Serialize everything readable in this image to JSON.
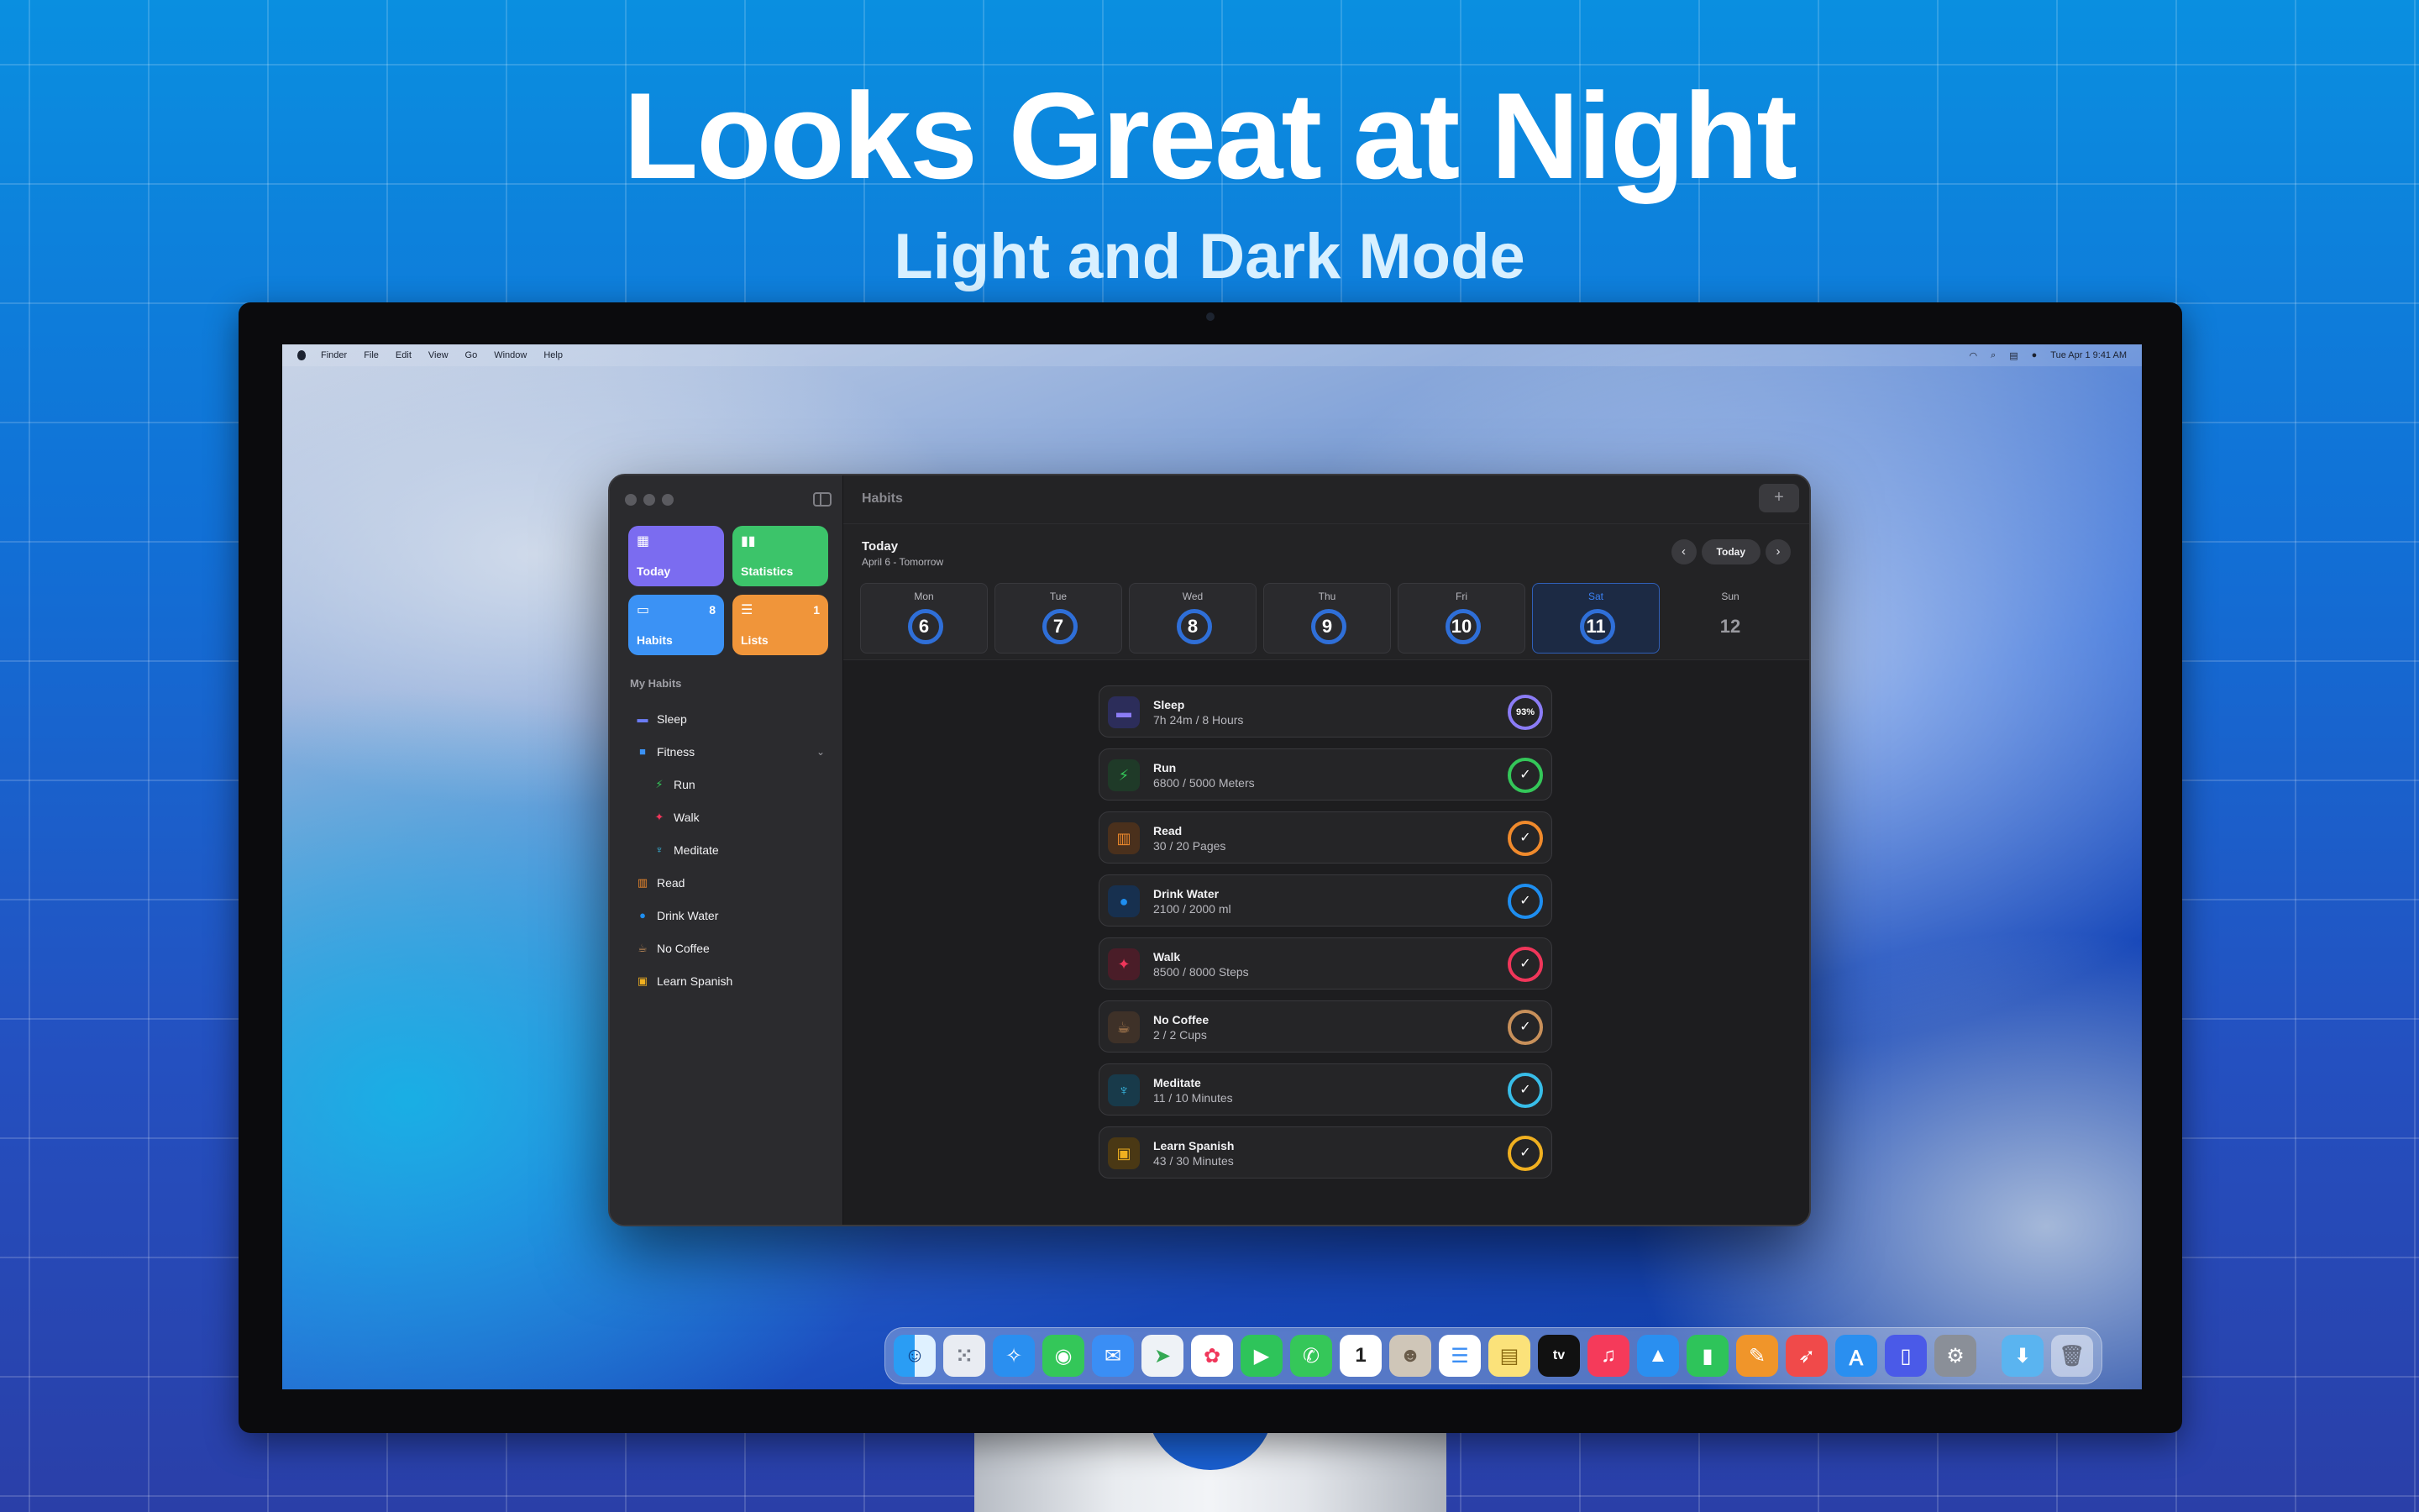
{
  "headline": "Looks Great at Night",
  "subheadline": "Light and Dark Mode",
  "menubar": {
    "items": [
      "Finder",
      "File",
      "Edit",
      "View",
      "Go",
      "Window",
      "Help"
    ],
    "clock": "Tue Apr 1  9:41 AM"
  },
  "app": {
    "title": "Habits",
    "tiles": [
      {
        "label": "Today",
        "count": "",
        "color": "#7b6cf0",
        "icon": "calendar-icon"
      },
      {
        "label": "Statistics",
        "count": "",
        "color": "#3cc46a",
        "icon": "bar-chart-icon"
      },
      {
        "label": "Habits",
        "count": "8",
        "color": "#3b92f5",
        "icon": "tray-icon"
      },
      {
        "label": "Lists",
        "count": "1",
        "color": "#f0953a",
        "icon": "list-icon"
      }
    ],
    "section_title": "My Habits",
    "nav": [
      {
        "label": "Sleep",
        "icon": "bed-icon"
      },
      {
        "label": "Fitness",
        "icon": "folder-icon"
      },
      {
        "label": "Run",
        "icon": "runner-icon"
      },
      {
        "label": "Walk",
        "icon": "walker-icon"
      },
      {
        "label": "Meditate",
        "icon": "meditate-icon"
      },
      {
        "label": "Read",
        "icon": "book-icon"
      },
      {
        "label": "Drink Water",
        "icon": "drop-icon"
      },
      {
        "label": "No Coffee",
        "icon": "cup-icon"
      },
      {
        "label": "Learn Spanish",
        "icon": "phrasebook-icon"
      }
    ],
    "header": {
      "today": "Today",
      "date": "April 6 - Tomorrow",
      "today_button": "Today",
      "add": "+"
    },
    "days": [
      {
        "name": "Mon",
        "num": "6"
      },
      {
        "name": "Tue",
        "num": "7"
      },
      {
        "name": "Wed",
        "num": "8"
      },
      {
        "name": "Thu",
        "num": "9"
      },
      {
        "name": "Fri",
        "num": "10"
      },
      {
        "name": "Sat",
        "num": "11"
      },
      {
        "name": "Sun",
        "num": "12"
      }
    ],
    "habits": [
      {
        "name": "Sleep",
        "progress": "7h 24m / 8 Hours",
        "badge": "93%",
        "color": "#8b7cf6",
        "icon": "bed-icon"
      },
      {
        "name": "Run",
        "progress": "6800 / 5000 Meters",
        "badge": "✓",
        "color": "#34c759",
        "icon": "runner-icon"
      },
      {
        "name": "Read",
        "progress": "30 / 20 Pages",
        "badge": "✓",
        "color": "#f08a2c",
        "icon": "book-icon"
      },
      {
        "name": "Drink Water",
        "progress": "2100 / 2000 ml",
        "badge": "✓",
        "color": "#1e8ef0",
        "icon": "drop-icon"
      },
      {
        "name": "Walk",
        "progress": "8500 / 8000 Steps",
        "badge": "✓",
        "color": "#f0365a",
        "icon": "walker-icon"
      },
      {
        "name": "No Coffee",
        "progress": "2 / 2 Cups",
        "badge": "✓",
        "color": "#c8905a",
        "icon": "cup-icon"
      },
      {
        "name": "Meditate",
        "progress": "11 / 10 Minutes",
        "badge": "✓",
        "color": "#38bde8",
        "icon": "meditate-icon"
      },
      {
        "name": "Learn Spanish",
        "progress": "43 / 30 Minutes",
        "badge": "✓",
        "color": "#f0b020",
        "icon": "phrasebook-icon"
      }
    ]
  },
  "dock": {
    "calendar_date": "1",
    "tv_label": "tv"
  }
}
